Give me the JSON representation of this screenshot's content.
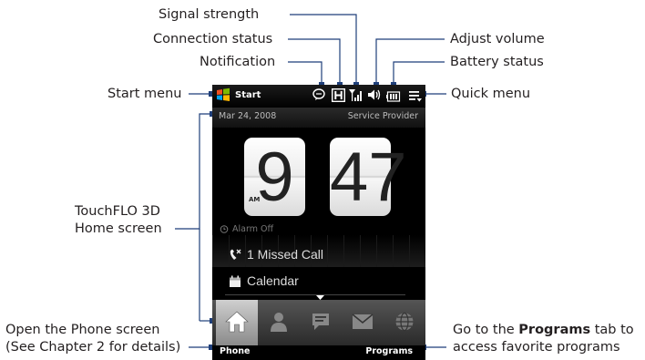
{
  "callouts": {
    "signal_strength": "Signal strength",
    "connection_status": "Connection status",
    "notification": "Notification",
    "adjust_volume": "Adjust volume",
    "battery_status": "Battery status",
    "start_menu": "Start menu",
    "quick_menu": "Quick menu",
    "home_line1": "TouchFLO 3D",
    "home_line2": "Home screen",
    "phone_line1": "Open the Phone screen",
    "phone_line2": "(See Chapter 2 for details)",
    "programs_pre": "Go to the ",
    "programs_bold": "Programs",
    "programs_post": " tab to",
    "programs_line2": "access favorite programs"
  },
  "phone": {
    "start_label": "Start",
    "date": "Mar 24, 2008",
    "provider": "Service Provider",
    "hour": "9",
    "minute": "47",
    "ampm": "AM",
    "alarm": "Alarm Off",
    "missed_call": "1 Missed Call",
    "calendar": "Calendar",
    "softkey_left": "Phone",
    "softkey_right": "Programs",
    "tabs": [
      "home-icon",
      "contacts-icon",
      "messages-icon",
      "email-icon",
      "internet-icon"
    ]
  },
  "colors": {
    "line": "#1f3f7a",
    "text": "#231f20",
    "screen": "#000000"
  }
}
